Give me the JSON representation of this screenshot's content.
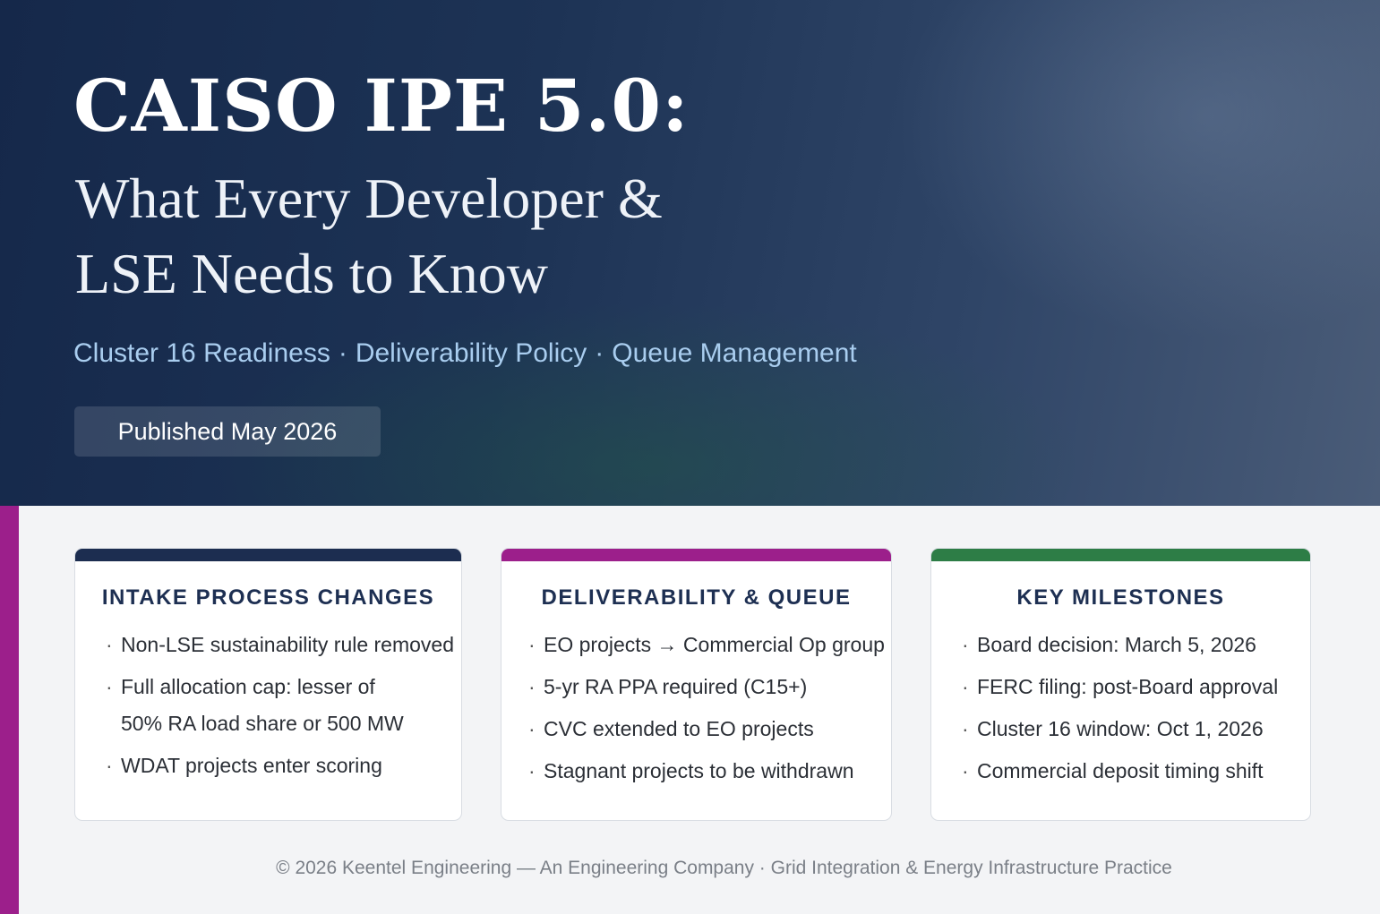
{
  "hero": {
    "title": "CAISO IPE 5.0:",
    "subtitle": "What Every Developer & LSE Needs to Know",
    "tagline": [
      "Cluster 16 Readiness",
      "Deliverability Policy",
      "Queue Management"
    ],
    "tagline_separator": "·",
    "published": "Published May 2026"
  },
  "cards": [
    {
      "heading": "INTAKE PROCESS CHANGES",
      "accent": "#1c2d50",
      "items": [
        "Non-LSE sustainability rule removed",
        "Full allocation cap: lesser of 50% RA load share or 500 MW",
        "WDAT projects enter scoring"
      ]
    },
    {
      "heading": "DELIVERABILITY & QUEUE",
      "accent": "#9c1f8b",
      "items": [
        "EO projects → Commercial Op group",
        "5-yr RA PPA required (C15+)",
        "CVC extended to EO projects",
        "Stagnant projects to be withdrawn"
      ]
    },
    {
      "heading": "KEY MILESTONES",
      "accent": "#2d7d46",
      "items": [
        "Board decision: March 5, 2026",
        "FERC filing: post-Board approval",
        "Cluster 16 window: Oct 1, 2026",
        "Commercial deposit timing shift"
      ]
    }
  ],
  "footer": "© 2026 Keentel Engineering — An Engineering Company · Grid Integration & Energy Infrastructure Practice",
  "colors": {
    "hero_bg": "#1d3355",
    "tagline": "#a9cdef",
    "side_accent": "#9c1f8b"
  }
}
